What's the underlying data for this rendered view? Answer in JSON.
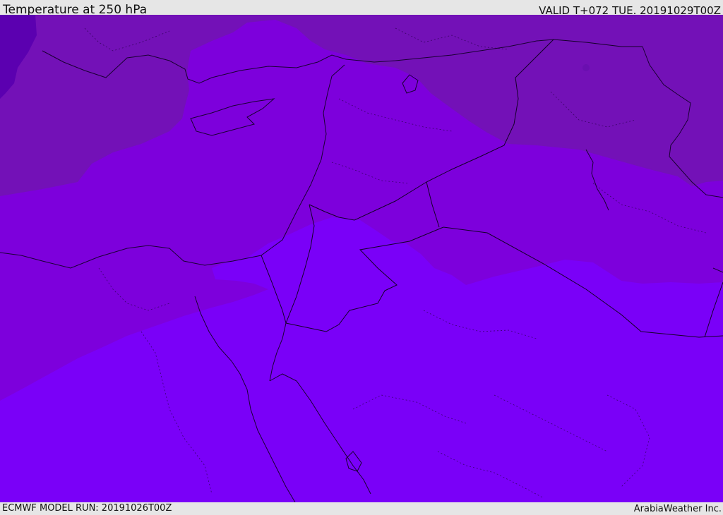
{
  "header": {
    "title": "Temperature at 250 hPa",
    "valid": "VALID T+072 TUE. 20191029T00Z"
  },
  "footer": {
    "model_run": "ECMWF MODEL RUN: 20191026T00Z",
    "credit": "ArabiaWeather Inc."
  },
  "map": {
    "colors": {
      "coldest": "#5b00b0",
      "cold": "#7311b7",
      "mid": "#7d00dc",
      "warm": "#7a00f8",
      "coast": "#1a0033"
    }
  }
}
